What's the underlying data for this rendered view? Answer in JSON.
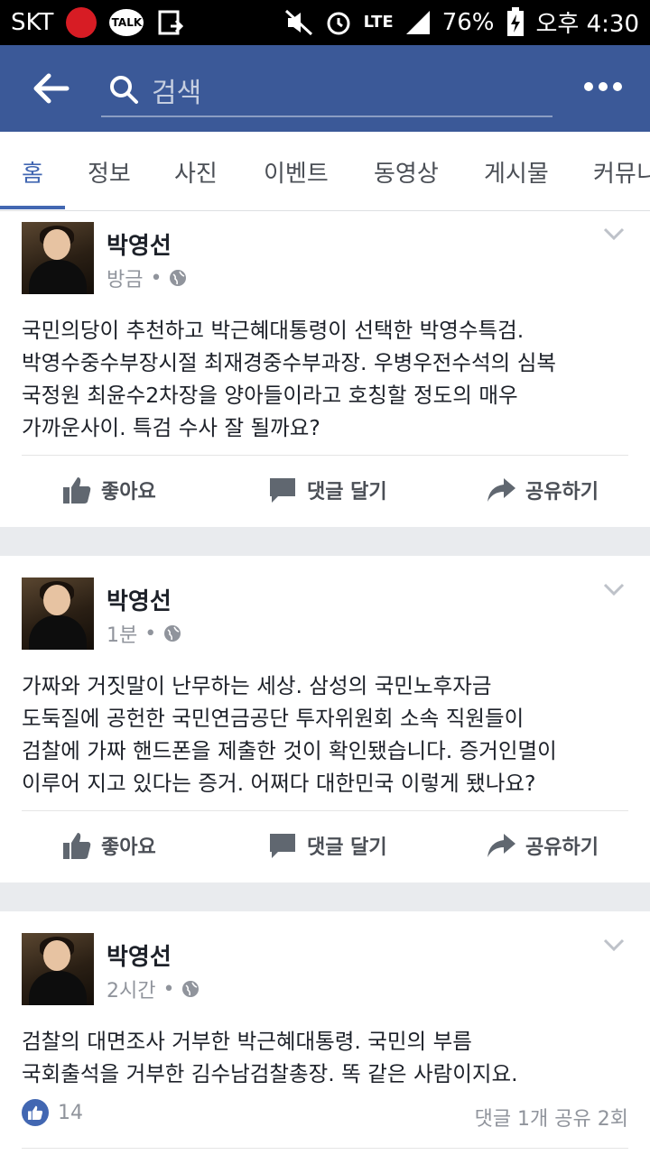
{
  "status_bar": {
    "carrier": "SKT",
    "battery": "76%",
    "network": "LTE",
    "time": "오후 4:30"
  },
  "app_bar": {
    "search_placeholder": "검색"
  },
  "tabs": [
    {
      "label": "홈",
      "active": true
    },
    {
      "label": "정보",
      "active": false
    },
    {
      "label": "사진",
      "active": false
    },
    {
      "label": "이벤트",
      "active": false
    },
    {
      "label": "동영상",
      "active": false
    },
    {
      "label": "게시물",
      "active": false
    },
    {
      "label": "커뮤니",
      "active": false
    }
  ],
  "posts": [
    {
      "author": "박영선",
      "time": "방금",
      "text": "국민의당이 추천하고 박근혜대통령이 선택한 박영수특검.\n박영수중수부장시절 최재경중수부과장. 우병우전수석의 심복\n국정원 최윤수2차장을 양아들이라고 호칭할 정도의 매우\n가까운사이. 특검 수사 잘 될까요?"
    },
    {
      "author": "박영선",
      "time": "1분",
      "text": "가짜와 거짓말이 난무하는 세상. 삼성의 국민노후자금\n도둑질에 공헌한 국민연금공단 투자위원회 소속 직원들이\n검찰에 가짜 핸드폰을 제출한 것이 확인됐습니다. 증거인멸이\n이루어 지고 있다는 증거. 어쩌다 대한민국 이렇게 됐나요?"
    },
    {
      "author": "박영선",
      "time": "2시간",
      "text": "검찰의 대면조사 거부한 박근혜대통령. 국민의 부름\n국회출석을 거부한 김수남검찰총장. 똑 같은 사람이지요.",
      "likes": "14",
      "stats": "댓글 1개 공유 2회"
    }
  ],
  "actions": {
    "like": "좋아요",
    "comment": "댓글 달기",
    "share": "공유하기"
  },
  "meta_separator": "•",
  "colors": {
    "brand": "#3b5998",
    "accent": "#4267b2",
    "background": "#e9ebee"
  }
}
